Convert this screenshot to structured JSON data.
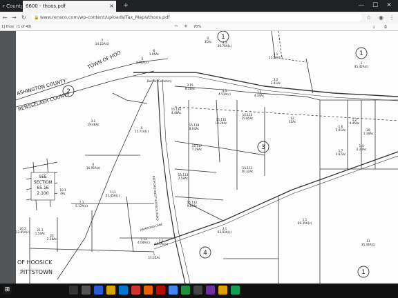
{
  "browser": {
    "tabs": [
      {
        "label": "r County",
        "active": false
      },
      {
        "label": "6600 - thoos.pdf",
        "active": true
      }
    ],
    "url": "www.rensco.com/wp-content/uploads/Tax_Maps/thoos.pdf",
    "window_controls": [
      "—",
      "☐",
      "✕"
    ]
  },
  "pdf_toolbar": {
    "left_label": "1] thoo",
    "page_count": "(1 of 43)",
    "zoom": "70%",
    "zoom_out": "−",
    "zoom_in": "+"
  },
  "map": {
    "county_labels": [
      "ASHINGTON COUNTY",
      "RENSSELAER COUNTY",
      "TOWN OF HOO"
    ],
    "town_labels": [
      "OF HOOSICK",
      "PITTSTOWN"
    ],
    "see_section": [
      "SEE",
      "SECTION",
      "65.16",
      "2.100"
    ],
    "sheet_numbers": [
      "1",
      "2",
      "3",
      "4",
      "1",
      "1"
    ],
    "cemetery_label": "Bucklin Cemetery",
    "road_labels": [
      "BEDFORD-WEST HOOSICK ROAD",
      "HAMMOND LANE"
    ],
    "parcels": [
      {
        "id": "3.3",
        "area": "36.76A(c)"
      },
      {
        "id": "2",
        "area": "31Ac"
      },
      {
        "id": "3.1",
        "area": "11.19A(c)"
      },
      {
        "id": "3.2",
        "area": "2.41Ac"
      },
      {
        "id": "2",
        "area": "45.42A(c)"
      },
      {
        "id": "7",
        "area": "14.15A(c)"
      },
      {
        "id": "6",
        "area": "1.95Ac"
      },
      {
        "id": "5",
        "area": "8.96A(c)"
      },
      {
        "id": "3.15",
        "area": "8.36Ac"
      },
      {
        "id": "4.5",
        "area": "4.51A(c)"
      },
      {
        "id": "3.5",
        "area": "4.34Ac"
      },
      {
        "id": "15.116",
        "area": "4.48Ac"
      },
      {
        "id": "15.118",
        "area": "8.04Ac"
      },
      {
        "id": "15.117",
        "area": "7.19Ac"
      },
      {
        "id": "15.115",
        "area": "18.24Ac"
      },
      {
        "id": "15.114",
        "area": "15.85Ac"
      },
      {
        "id": "12",
        "area": "31Ac"
      },
      {
        "id": "5",
        "area": "15.71A(c)"
      },
      {
        "id": "3.1",
        "area": "19.48Ac"
      },
      {
        "id": "6",
        "area": "16.95A(c)"
      },
      {
        "id": "15.113",
        "area": "7.59Ac"
      },
      {
        "id": "15.111",
        "area": "50.32Ac"
      },
      {
        "id": "7.11",
        "area": "21.45A(c)"
      },
      {
        "id": "15.112",
        "area": "9.09Ac"
      },
      {
        "id": "7.3",
        "area": "5.17A(c)"
      },
      {
        "id": "10.1",
        "area": "4Ac"
      },
      {
        "id": "1.1",
        "area": "69.35A(c)"
      },
      {
        "id": "11",
        "area": "35.44A(c)"
      },
      {
        "id": "3.1",
        "area": "63.93A(c)"
      },
      {
        "id": "1",
        "area": "11.25Ac"
      },
      {
        "id": "2.1",
        "area": "4.17Ac(c)"
      },
      {
        "id": "1.6",
        "area": "5.91Ac"
      },
      {
        "id": "1.2",
        "area": "4.45Ac"
      },
      {
        "id": "1.7",
        "area": "3.97Ac"
      },
      {
        "id": "1.4",
        "area": "2.20Ac"
      },
      {
        "id": "7.13",
        "area": "4.04A(c)"
      },
      {
        "id": "20.2",
        "area": "12.85A(c)"
      },
      {
        "id": "22.1",
        "area": "1.50Ac"
      },
      {
        "id": "23",
        "area": "2.28Ac"
      },
      {
        "id": "28",
        "area": "1.16Ac"
      }
    ]
  },
  "taskbar": {
    "time": "",
    "date": ""
  },
  "colors": {
    "tabbar": "#202124",
    "viewer_bg": "#525659",
    "taskbar": "#111111",
    "map_lines": "#333333"
  }
}
